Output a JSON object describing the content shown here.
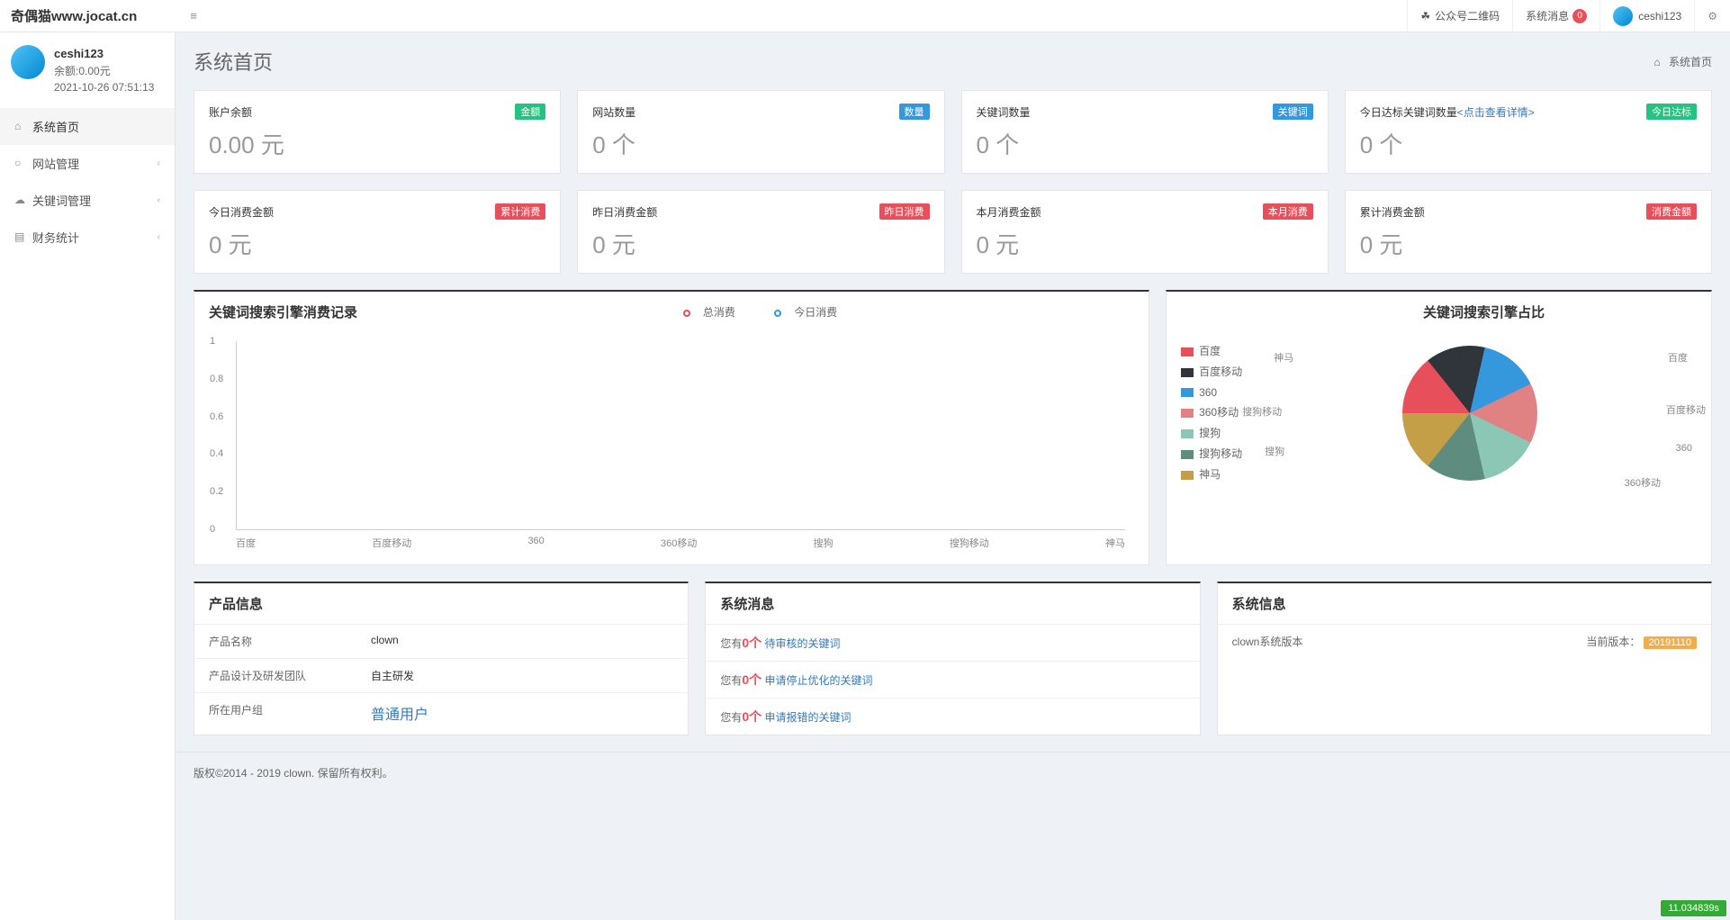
{
  "header": {
    "logo": "奇偶猫www.jocat.cn",
    "qrcode": "公众号二维码",
    "sysmsg": "系统消息",
    "sysmsg_badge": "0",
    "username": "ceshi123"
  },
  "sidebar": {
    "username": "ceshi123",
    "balance": "余额:0.00元",
    "timestamp": "2021-10-26 07:51:13",
    "menu": [
      {
        "icon": "⌂",
        "label": "系统首页",
        "active": true,
        "arrow": false
      },
      {
        "icon": "○",
        "label": "网站管理",
        "active": false,
        "arrow": true
      },
      {
        "icon": "☁",
        "label": "关键词管理",
        "active": false,
        "arrow": true
      },
      {
        "icon": "▤",
        "label": "财务统计",
        "active": false,
        "arrow": true
      }
    ]
  },
  "page": {
    "title": "系统首页",
    "breadcrumb_home_icon": "⌂",
    "breadcrumb": "系统首页"
  },
  "cards1": [
    {
      "label": "账户余额",
      "tag": "金额",
      "tagclass": "tag-green",
      "value": "0.00 元"
    },
    {
      "label": "网站数量",
      "tag": "数量",
      "tagclass": "tag-blue",
      "value": "0 个"
    },
    {
      "label": "关键词数量",
      "tag": "关键词",
      "tagclass": "tag-blue",
      "value": "0 个"
    },
    {
      "label": "今日达标关键词数量",
      "link": "<点击查看详情>",
      "tag": "今日达标",
      "tagclass": "tag-green",
      "value": "0 个"
    }
  ],
  "cards2": [
    {
      "label": "今日消费金额",
      "tag": "累计消费",
      "tagclass": "tag-red",
      "value": "0 元"
    },
    {
      "label": "昨日消费金额",
      "tag": "昨日消费",
      "tagclass": "tag-red",
      "value": "0 元"
    },
    {
      "label": "本月消费金额",
      "tag": "本月消费",
      "tagclass": "tag-red",
      "value": "0 元"
    },
    {
      "label": "累计消费金额",
      "tag": "消费金额",
      "tagclass": "tag-red",
      "value": "0 元"
    }
  ],
  "line_chart": {
    "title": "关键词搜索引擎消费记录",
    "legend": [
      "总消费",
      "今日消费"
    ],
    "yticks": [
      "1",
      "0.8",
      "0.6",
      "0.4",
      "0.2",
      "0"
    ],
    "xticks": [
      "百度",
      "百度移动",
      "360",
      "360移动",
      "搜狗",
      "搜狗移动",
      "神马"
    ]
  },
  "pie_chart": {
    "title": "关键词搜索引擎占比",
    "legend": [
      {
        "name": "百度",
        "color": "#e7505a"
      },
      {
        "name": "百度移动",
        "color": "#2f353b"
      },
      {
        "name": "360",
        "color": "#3598dc"
      },
      {
        "name": "360移动",
        "color": "#e08283"
      },
      {
        "name": "搜狗",
        "color": "#8bc7b4"
      },
      {
        "name": "搜狗移动",
        "color": "#5e8c7e"
      },
      {
        "name": "神马",
        "color": "#c49f47"
      }
    ],
    "slice_labels": [
      "百度",
      "百度移动",
      "360",
      "360移动",
      "搜狗",
      "搜狗移动",
      "神马"
    ]
  },
  "product": {
    "title": "产品信息",
    "rows": [
      {
        "k": "产品名称",
        "v": "clown"
      },
      {
        "k": "产品设计及研发团队",
        "v": "自主研发"
      },
      {
        "k": "所在用户组",
        "v": "普通用户",
        "link": true
      }
    ]
  },
  "sysmsg_panel": {
    "title": "系统消息",
    "rows": [
      {
        "prefix": "您有",
        "count": "0个",
        "link": "待审核的关键词"
      },
      {
        "prefix": "您有",
        "count": "0个",
        "link": "申请停止优化的关键词"
      },
      {
        "prefix": "您有",
        "count": "0个",
        "link": "申请报错的关键词"
      }
    ]
  },
  "sysinfo": {
    "title": "系统信息",
    "row": {
      "k": "clown系统版本",
      "label": "当前版本：",
      "tag": "20191110"
    }
  },
  "footer": "版权©2014 - 2019 clown. 保留所有权利。",
  "perf": "11.034839s",
  "chart_data": [
    {
      "type": "line",
      "title": "关键词搜索引擎消费记录",
      "categories": [
        "百度",
        "百度移动",
        "360",
        "360移动",
        "搜狗",
        "搜狗移动",
        "神马"
      ],
      "series": [
        {
          "name": "总消费",
          "values": [
            0,
            0,
            0,
            0,
            0,
            0,
            0
          ]
        },
        {
          "name": "今日消费",
          "values": [
            0,
            0,
            0,
            0,
            0,
            0,
            0
          ]
        }
      ],
      "ylim": [
        0,
        1
      ],
      "xlabel": "",
      "ylabel": ""
    },
    {
      "type": "pie",
      "title": "关键词搜索引擎占比",
      "categories": [
        "百度",
        "百度移动",
        "360",
        "360移动",
        "搜狗",
        "搜狗移动",
        "神马"
      ],
      "values": [
        14.3,
        14.3,
        14.3,
        14.3,
        14.3,
        14.3,
        14.3
      ]
    }
  ]
}
